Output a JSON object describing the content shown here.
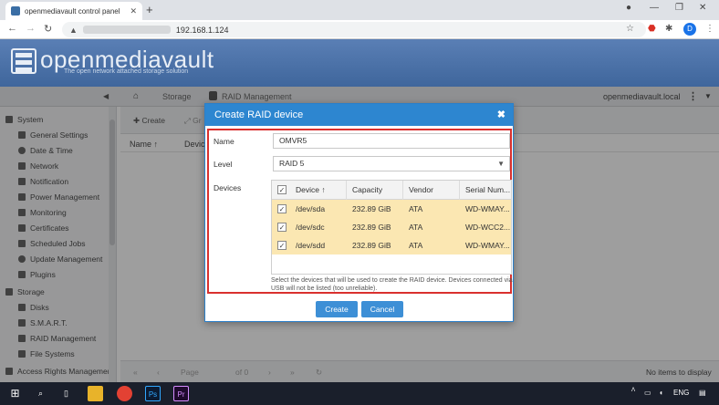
{
  "browser": {
    "tab_title": "openmediavault control panel",
    "url": "192.168.1.124"
  },
  "omv": {
    "logo_text": "openmediavault",
    "logo_subtitle": "The open network attached storage solution",
    "breadcrumb": [
      "Storage",
      "RAID Management"
    ],
    "hostname": "openmediavault.local"
  },
  "sidebar": {
    "groups": [
      {
        "label": "System",
        "icon": "system-icon",
        "items": [
          {
            "label": "General Settings",
            "icon": "sliders-icon"
          },
          {
            "label": "Date & Time",
            "icon": "clock-icon"
          },
          {
            "label": "Network",
            "icon": "network-icon"
          },
          {
            "label": "Notification",
            "icon": "envelope-icon"
          },
          {
            "label": "Power Management",
            "icon": "power-icon"
          },
          {
            "label": "Monitoring",
            "icon": "heartbeat-icon"
          },
          {
            "label": "Certificates",
            "icon": "certificate-icon"
          },
          {
            "label": "Scheduled Jobs",
            "icon": "calendar-icon"
          },
          {
            "label": "Update Management",
            "icon": "refresh-icon"
          },
          {
            "label": "Plugins",
            "icon": "puzzle-icon"
          }
        ]
      },
      {
        "label": "Storage",
        "icon": "storage-icon",
        "items": [
          {
            "label": "Disks",
            "icon": "disk-icon"
          },
          {
            "label": "S.M.A.R.T.",
            "icon": "pulse-icon"
          },
          {
            "label": "RAID Management",
            "icon": "raid-icon"
          },
          {
            "label": "File Systems",
            "icon": "filesystem-icon"
          }
        ]
      },
      {
        "label": "Access Rights Managemer",
        "icon": "access-icon",
        "items": []
      }
    ]
  },
  "main": {
    "toolbar": {
      "create": "Create",
      "grow": "Gr"
    },
    "columns": [
      "Name",
      "Devic"
    ],
    "pager": {
      "page_label": "Page",
      "of_label": "of 0",
      "status": "No items to display"
    }
  },
  "dialog": {
    "title": "Create RAID device",
    "name_label": "Name",
    "name_value": "OMVR5",
    "level_label": "Level",
    "level_value": "RAID 5",
    "devices_label": "Devices",
    "grid_columns": [
      "Device",
      "Capacity",
      "Vendor",
      "Serial Num..."
    ],
    "devices": [
      {
        "device": "/dev/sda",
        "capacity": "232.89 GiB",
        "vendor": "ATA",
        "serial": "WD-WMAY..."
      },
      {
        "device": "/dev/sdc",
        "capacity": "232.89 GiB",
        "vendor": "ATA",
        "serial": "WD-WCC2..."
      },
      {
        "device": "/dev/sdd",
        "capacity": "232.89 GiB",
        "vendor": "ATA",
        "serial": "WD-WMAY..."
      }
    ],
    "hint": "Select the devices that will be used to create the RAID device. Devices connected via USB will not be listed (too unreliable).",
    "create_button": "Create",
    "cancel_button": "Cancel"
  },
  "taskbar": {
    "lang": "ENG"
  },
  "colors": {
    "accent": "#2d86d0",
    "selection": "#fbe7b2",
    "highlight_box": "#d9302e",
    "header": "#4a6fa5"
  }
}
